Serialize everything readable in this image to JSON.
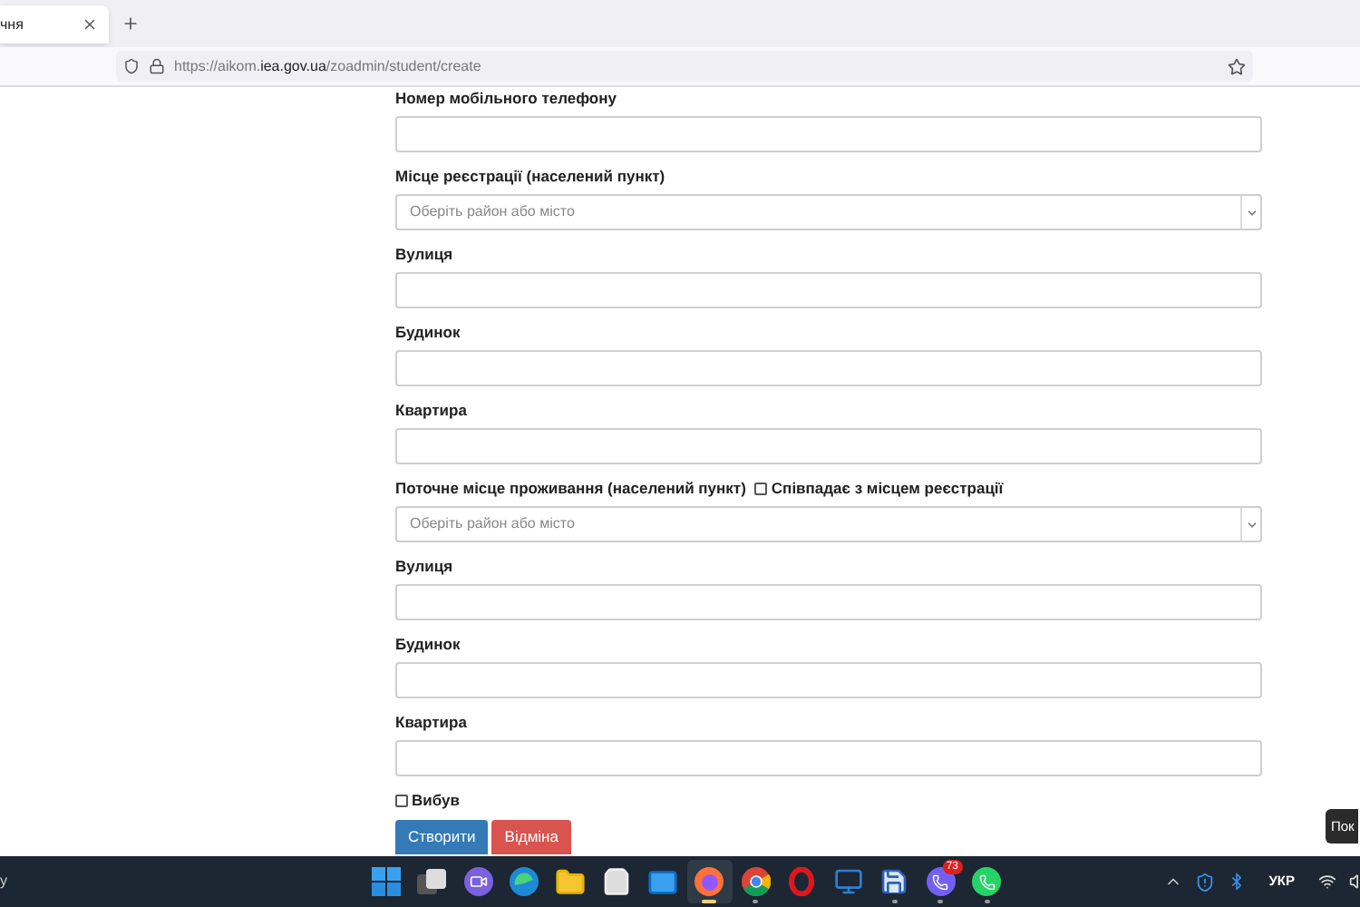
{
  "browser": {
    "tab": {
      "title": "чня"
    },
    "url": {
      "scheme": "https://aikom.",
      "domain": "iea.gov.ua",
      "path": "/zoadmin/student/create"
    }
  },
  "form": {
    "fields": [
      {
        "label": "Номер мобільного телефону",
        "kind": "text"
      },
      {
        "label": "Місце реєстрації (населений пункт)",
        "kind": "select",
        "placeholder": "Оберіть район або місто"
      },
      {
        "label": "Вулиця",
        "kind": "text"
      },
      {
        "label": "Будинок",
        "kind": "text"
      },
      {
        "label": "Квартира",
        "kind": "text"
      },
      {
        "label": "Поточне місце проживання (населений пункт)",
        "kind": "select",
        "placeholder": "Оберіть район або місто",
        "same_as": {
          "label": "Співпадає з місцем реєстрації",
          "checked": false
        }
      },
      {
        "label": "Вулиця",
        "kind": "text"
      },
      {
        "label": "Будинок",
        "kind": "text"
      },
      {
        "label": "Квартира",
        "kind": "text"
      }
    ],
    "left_checkbox": {
      "label": "Вибув",
      "checked": false
    },
    "buttons": [
      {
        "label": "Створити",
        "kind": "primary"
      },
      {
        "label": "Відміна",
        "kind": "danger"
      }
    ]
  },
  "tooltip": "Пок",
  "taskbar": {
    "left_text": "y",
    "apps": [
      {
        "kind": "start",
        "selected": false,
        "running": false
      },
      {
        "kind": "taskview",
        "selected": false,
        "running": false
      },
      {
        "kind": "meet",
        "selected": false,
        "running": false
      },
      {
        "kind": "edge",
        "selected": false,
        "running": false
      },
      {
        "kind": "files",
        "selected": false,
        "running": false
      },
      {
        "kind": "store",
        "selected": false,
        "running": false
      },
      {
        "kind": "mail",
        "selected": false,
        "running": false
      },
      {
        "kind": "firefox",
        "selected": true,
        "running": true
      },
      {
        "kind": "chrome",
        "selected": false,
        "running": true
      },
      {
        "kind": "opera",
        "selected": false,
        "running": false
      },
      {
        "kind": "network",
        "selected": false,
        "running": false
      },
      {
        "kind": "floppy",
        "selected": false,
        "running": true
      },
      {
        "kind": "viber",
        "selected": false,
        "running": true,
        "badge": "73"
      },
      {
        "kind": "whatsapp",
        "selected": false,
        "running": true
      }
    ],
    "language": "УКР"
  }
}
